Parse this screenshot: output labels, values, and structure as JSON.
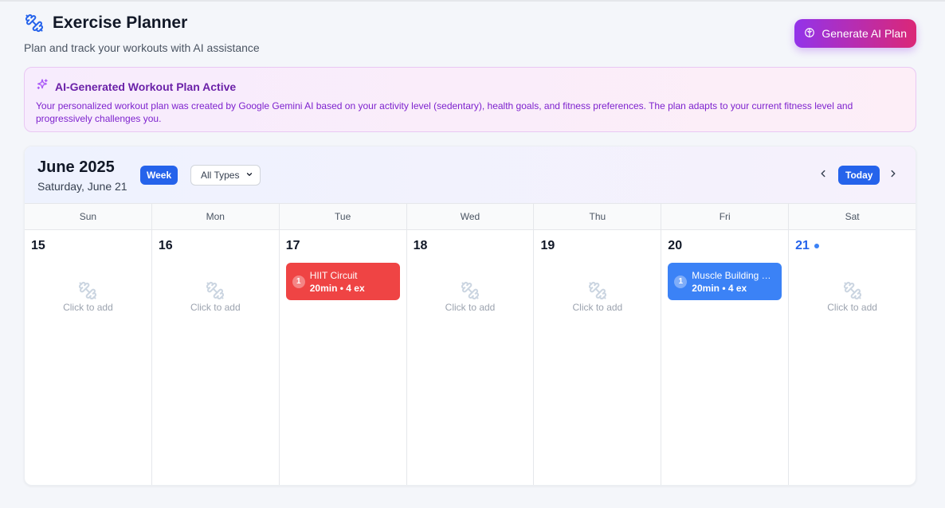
{
  "header": {
    "title": "Exercise Planner",
    "subtitle": "Plan and track your workouts with AI assistance",
    "generate_label": "Generate AI Plan"
  },
  "banner": {
    "title": "AI-Generated Workout Plan Active",
    "text": "Your personalized workout plan was created by Google Gemini AI based on your activity level (sedentary), health goals, and fitness preferences. The plan adapts to your current fitness level and progressively challenges you."
  },
  "calendar": {
    "month": "June 2025",
    "date": "Saturday, June 21",
    "view_label": "Week",
    "filter_value": "All Types",
    "today_label": "Today",
    "weekdays": [
      "Sun",
      "Mon",
      "Tue",
      "Wed",
      "Thu",
      "Fri",
      "Sat"
    ],
    "empty_label": "Click to add",
    "days": [
      {
        "num": "15"
      },
      {
        "num": "16"
      },
      {
        "num": "17",
        "workout": {
          "count": "1",
          "name": "HIIT Circuit",
          "meta": "20min • 4 ex",
          "color": "#ef4444"
        }
      },
      {
        "num": "18"
      },
      {
        "num": "19"
      },
      {
        "num": "20",
        "workout": {
          "count": "1",
          "name": "Muscle Building Workout",
          "meta": "20min • 4 ex",
          "color": "#3b82f6"
        }
      },
      {
        "num": "21"
      }
    ]
  },
  "colors": {
    "accent": "#2563eb",
    "ai_gradient_start": "#9333ea",
    "ai_gradient_end": "#db2777",
    "today_dot": "#3b82f6"
  }
}
